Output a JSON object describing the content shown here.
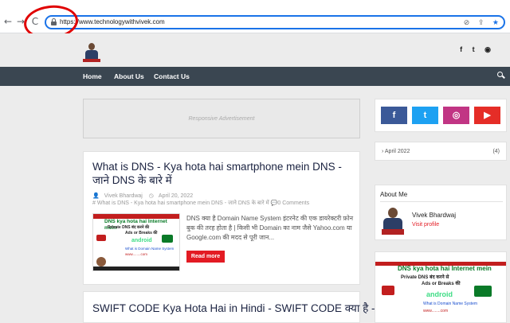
{
  "browser": {
    "back": "←",
    "forward": "→",
    "reload": "C",
    "url": "https://www.technologywithvivek.com",
    "icons": [
      "eye-off-icon",
      "share-icon",
      "star-icon"
    ],
    "star_color": "#1a73e8"
  },
  "header": {
    "social_icons": [
      "f",
      "t",
      "◉"
    ]
  },
  "nav": {
    "items": [
      "Home",
      "About Us",
      "Contact Us"
    ]
  },
  "ad": {
    "text": "Responsive Advertisement"
  },
  "posts": [
    {
      "title": "What is DNS - Kya hota hai smartphone mein DNS - जाने DNS के बारे में",
      "author": "Vivek Bhardwaj",
      "date": "April 20, 2022",
      "label": "What is DNS - Kya hota hai smartphone mein DNS - जाने DNS के बारे में",
      "comments": "0 Comments",
      "excerpt": "DNS क्या है  Domain Name System इंटरनेट की एक डायरेक्टरी फ़ोन बुक की तरह होता है | किसी भी Domain का नाम जैसे Yahoo.com या Google.com की मदद से पूरी जान...",
      "read_more": "Read more",
      "thumb": {
        "line1": "DNS kya hota hai Internet mein",
        "line2": "Private DNS बंद करने की",
        "line3": "Ads or Breaks की",
        "android": "android",
        "line4": "What is Domain Name System",
        "line5": "www........com"
      }
    },
    {
      "title": "SWIFT CODE Kya Hota Hai in Hindi - SWIFT CODE क्या है -"
    }
  ],
  "sidebar": {
    "social": [
      "f",
      "t",
      "◎",
      "▶"
    ],
    "social_colors": [
      "#3b5998",
      "#1da1f2",
      "#c13584",
      "#e52d27"
    ],
    "archive": {
      "label": "› April 2022",
      "count": "(4)"
    },
    "about": {
      "title": "About Me",
      "name": "Vivek Bhardwaj",
      "link": "Visit profile"
    },
    "banner": {
      "line1": "DNS kya hota hai Internet mein",
      "line2": "Private DNS बंद करने से",
      "line3": "Ads or Breaks की",
      "android": "android",
      "line4": "What is Domain Name System",
      "line5": "www........com"
    }
  },
  "colors": {
    "nav_bg": "#3a4651",
    "accent": "#e31b23",
    "highlight": "#e00000"
  }
}
